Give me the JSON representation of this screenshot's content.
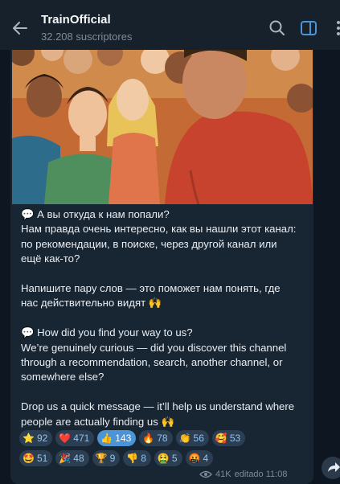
{
  "header": {
    "title": "TrainOfficial",
    "subscribers": "32.208 suscriptores"
  },
  "message": {
    "paragraphs": [
      "💬 А вы откуда к нам попали?\nНам правда очень интересно, как вы нашли этот канал:\nпо рекомендации, в поиске, через другой канал или\nещё как-то?",
      "Напишите пару слов — это поможет нам понять, где\nнас действительно видят 🙌",
      "💬 How did you find your way to us?\nWe’re genuinely curious — did you discover this channel\nthrough a recommendation, search, another channel, or\nsomewhere else?",
      "Drop us a quick message — it’ll help us understand where\npeople are actually finding us 🙌"
    ],
    "views": "41K",
    "edited": "editado 11:08"
  },
  "reactions": [
    {
      "emoji": "⭐",
      "count": "92",
      "active": false
    },
    {
      "emoji": "❤️",
      "count": "471",
      "active": false
    },
    {
      "emoji": "👍",
      "count": "143",
      "active": true
    },
    {
      "emoji": "🔥",
      "count": "78",
      "active": false
    },
    {
      "emoji": "👏",
      "count": "56",
      "active": false
    },
    {
      "emoji": "🥰",
      "count": "53",
      "active": false
    },
    {
      "emoji": "🤩",
      "count": "51",
      "active": false
    },
    {
      "emoji": "🎉",
      "count": "48",
      "active": false
    },
    {
      "emoji": "🏆",
      "count": "9",
      "active": false
    },
    {
      "emoji": "👎",
      "count": "8",
      "active": false
    },
    {
      "emoji": "🤮",
      "count": "5",
      "active": false
    },
    {
      "emoji": "🤬",
      "count": "4",
      "active": false
    }
  ],
  "icons": {
    "back": "arrow-left-icon",
    "search": "search-icon",
    "sidebar": "sidebar-toggle-icon",
    "more": "more-vertical-icon",
    "forward": "forward-icon",
    "views": "eye-icon"
  },
  "colors": {
    "header_bg": "#17212b",
    "chat_bg": "#0e1621",
    "bubble_bg": "#182533",
    "accent": "#4b94d6"
  }
}
